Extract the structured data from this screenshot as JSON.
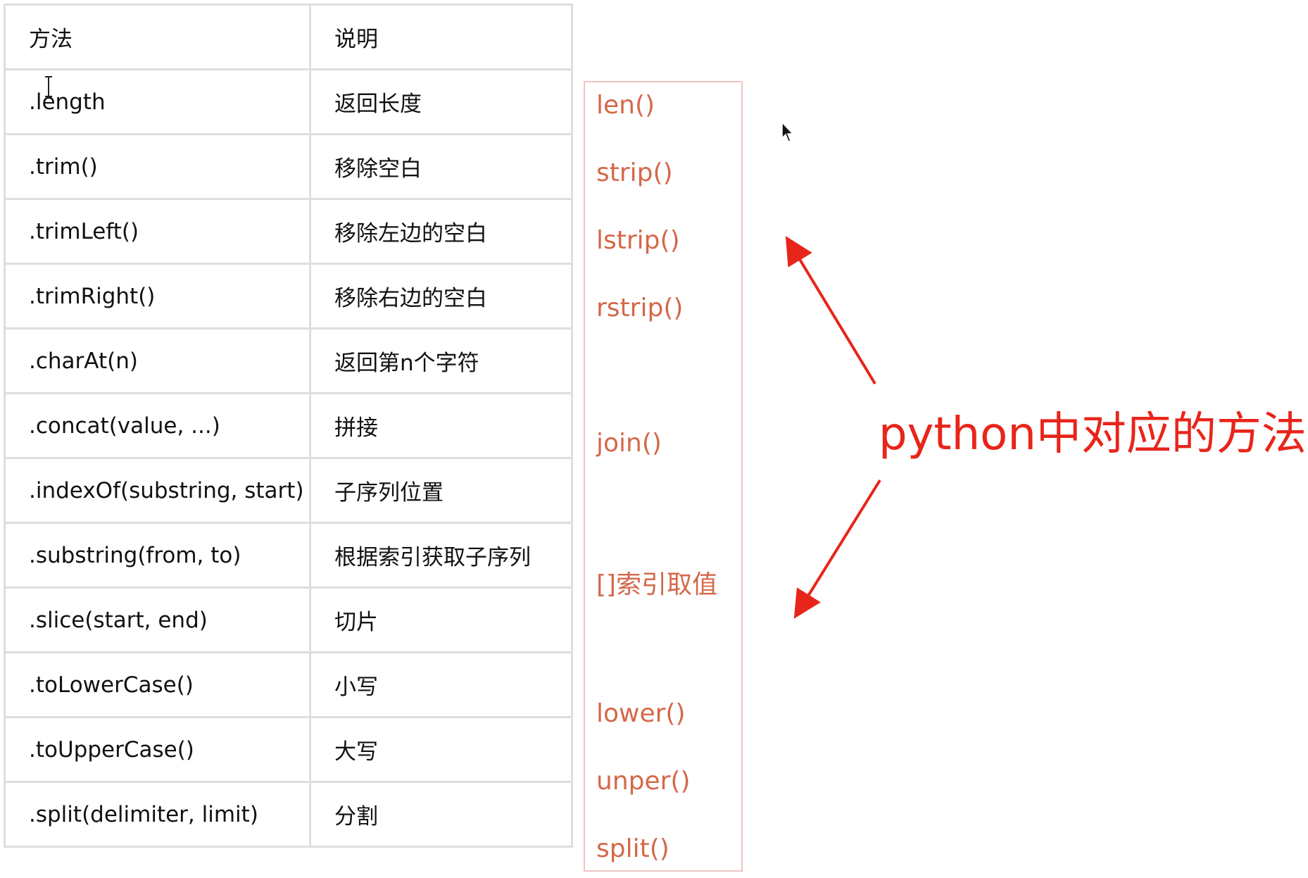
{
  "table": {
    "headers": [
      "方法",
      "说明"
    ],
    "rows": [
      [
        ".length",
        "返回长度"
      ],
      [
        ".trim()",
        "移除空白"
      ],
      [
        ".trimLeft()",
        "移除左边的空白"
      ],
      [
        ".trimRight()",
        "移除右边的空白"
      ],
      [
        ".charAt(n)",
        "返回第n个字符"
      ],
      [
        ".concat(value, ...)",
        "拼接"
      ],
      [
        ".indexOf(substring, start)",
        "子序列位置"
      ],
      [
        ".substring(from, to)",
        "根据索引获取子序列"
      ],
      [
        ".slice(start, end)",
        "切片"
      ],
      [
        ".toLowerCase()",
        "小写"
      ],
      [
        ".toUpperCase()",
        "大写"
      ],
      [
        ".split(delimiter, limit)",
        "分割"
      ]
    ]
  },
  "python_methods": [
    "len()",
    "strip()",
    "lstrip()",
    "rstrip()",
    "join()",
    "[]索引取值",
    "lower()",
    "unper()",
    "split()"
  ],
  "annotation": {
    "text": "python中对应的方法",
    "color": "#e8251b"
  },
  "colors": {
    "python_text": "#d4684a",
    "box_border": "#f1c4c4",
    "table_border": "#dedede"
  },
  "icons": [
    "mouse-pointer-icon",
    "text-cursor-icon"
  ]
}
